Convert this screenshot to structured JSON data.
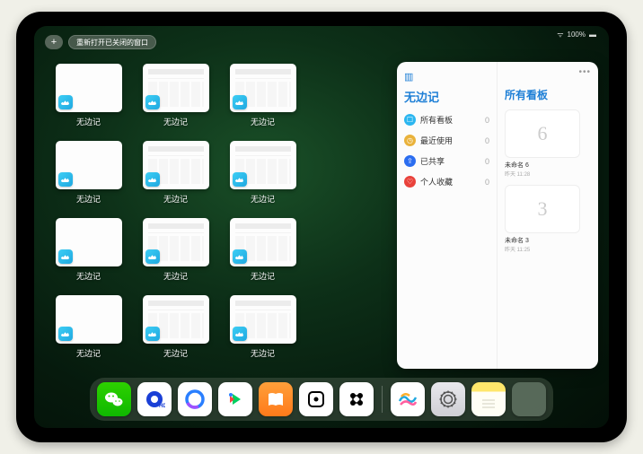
{
  "status": {
    "wifi": "᯾",
    "battery": "100%"
  },
  "top": {
    "plus": "+",
    "reopen": "重新打开已关闭的窗口"
  },
  "windows": [
    {
      "label": "无边记",
      "variant": "blank"
    },
    {
      "label": "无边记",
      "variant": "detailed"
    },
    {
      "label": "无边记",
      "variant": "detailed"
    },
    {
      "label": "无边记",
      "variant": "blank"
    },
    {
      "label": "无边记",
      "variant": "detailed"
    },
    {
      "label": "无边记",
      "variant": "detailed"
    },
    {
      "label": "无边记",
      "variant": "blank"
    },
    {
      "label": "无边记",
      "variant": "detailed"
    },
    {
      "label": "无边记",
      "variant": "detailed"
    },
    {
      "label": "无边记",
      "variant": "blank"
    },
    {
      "label": "无边记",
      "variant": "detailed"
    },
    {
      "label": "无边记",
      "variant": "detailed"
    }
  ],
  "panel": {
    "more": "•••",
    "title": "无边记",
    "rows": [
      {
        "icon_bg": "#2bb6f0",
        "glyph": "☐",
        "label": "所有看板",
        "count": "0"
      },
      {
        "icon_bg": "#e9b23b",
        "glyph": "◷",
        "label": "最近使用",
        "count": "0"
      },
      {
        "icon_bg": "#2b6df0",
        "glyph": "⇪",
        "label": "已共享",
        "count": "0"
      },
      {
        "icon_bg": "#e9423b",
        "glyph": "♡",
        "label": "个人收藏",
        "count": "0"
      }
    ],
    "right_title": "所有看板",
    "boards": [
      {
        "scribble": "6",
        "name": "未命名 6",
        "time": "昨天 11:28"
      },
      {
        "scribble": "3",
        "name": "未命名 3",
        "time": "昨天 11:25"
      }
    ]
  },
  "dock": {
    "apps": [
      {
        "id": "wechat"
      },
      {
        "id": "tencent"
      },
      {
        "id": "quark"
      },
      {
        "id": "aqiy"
      },
      {
        "id": "books"
      },
      {
        "id": "dice"
      },
      {
        "id": "hex"
      }
    ],
    "recent": [
      {
        "id": "freeform"
      },
      {
        "id": "settings"
      },
      {
        "id": "notes"
      },
      {
        "id": "folder"
      }
    ]
  }
}
